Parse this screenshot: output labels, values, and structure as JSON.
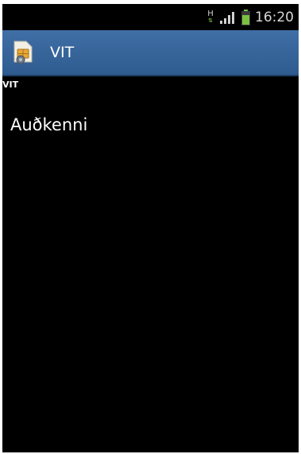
{
  "status_bar": {
    "network": "H",
    "time": "16:20",
    "icons": [
      "network-type-icon",
      "signal-icon",
      "battery-icon"
    ],
    "battery_color": "#7ac142"
  },
  "action_bar": {
    "title": "VIT",
    "app_icon": "sim-card-icon",
    "background": "#3a6aa0"
  },
  "content": {
    "section_header": "VIT",
    "items": [
      {
        "label": "Auðkenni"
      }
    ]
  }
}
